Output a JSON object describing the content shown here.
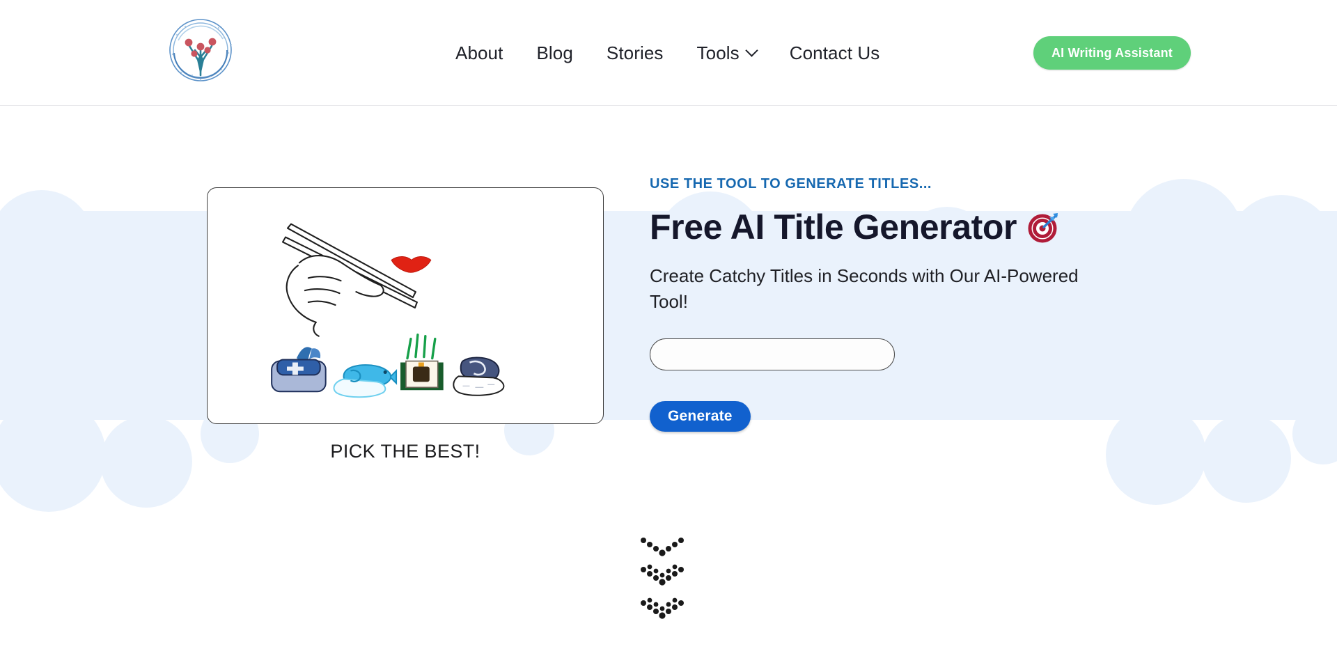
{
  "header": {
    "logo_icon": "brand-circuit-plant-logo-icon",
    "nav": [
      {
        "label": "About",
        "has_dropdown": false
      },
      {
        "label": "Blog",
        "has_dropdown": false
      },
      {
        "label": "Stories",
        "has_dropdown": false
      },
      {
        "label": "Tools",
        "has_dropdown": true
      },
      {
        "label": "Contact Us",
        "has_dropdown": false
      }
    ],
    "cta_label": "AI Writing Assistant",
    "cta_color": "#5fd07a"
  },
  "hero": {
    "eyebrow": "USE THE TOOL TO GENERATE TITLES...",
    "eyebrow_color": "#1668b0",
    "title": "Free AI Title Generator",
    "title_emoji": "target-dart-emoji",
    "subtitle": "Create Catchy Titles in Seconds with Our AI-Powered Tool!",
    "input_value": "",
    "input_placeholder": "",
    "generate_label": "Generate",
    "generate_color": "#1161ce",
    "illustration_icon": "sushi-chopsticks-illustration",
    "illustration_caption": "PICK THE BEST!"
  },
  "background": {
    "cloud_color": "#eaf2fc",
    "page_color": "#ffffff"
  },
  "scroll_indicator": {
    "icon": "dotted-chevron-down-arrows-icon",
    "count": 3
  }
}
